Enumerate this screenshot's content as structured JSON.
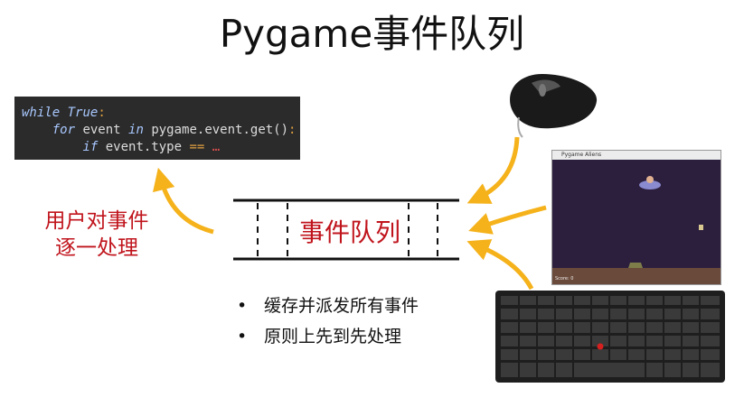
{
  "title": "Pygame事件队列",
  "code": {
    "line1": {
      "kw": "while",
      "rest": " True",
      "colon": ":"
    },
    "line2": {
      "indent": "    ",
      "kw_for": "for",
      "var": " event ",
      "kw_in": "in",
      "call": " pygame.event.get()",
      "colon": ":"
    },
    "line3": {
      "indent": "        ",
      "kw_if": "if",
      "expr": " event.type ",
      "op": "==",
      "ell": " …"
    }
  },
  "left_label": {
    "line1": "用户对事件",
    "line2": "逐一处理"
  },
  "queue_label": "事件队列",
  "bullets": [
    "缓存并派发所有事件",
    "原则上先到先处理"
  ],
  "bullet_symbol": "•",
  "game_window": {
    "title": "Pygame Aliens",
    "score": "Score: 0"
  },
  "colors": {
    "accent_red": "#c0141c",
    "arrow_yellow": "#f5b21a",
    "code_bg": "#2b2b2b"
  },
  "icons": [
    "mouse-icon",
    "keyboard-icon",
    "game-screenshot"
  ]
}
